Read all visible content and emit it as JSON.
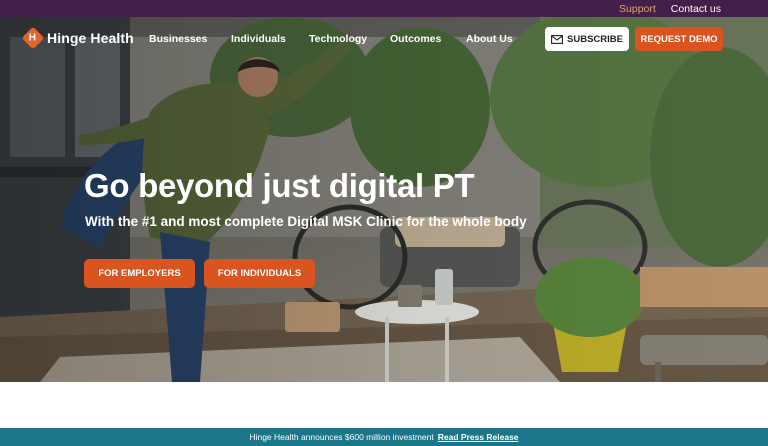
{
  "utility_bar": {
    "support_label": "Support",
    "contact_label": "Contact us"
  },
  "nav": {
    "logo_text": "Hinge Health",
    "logo_letter": "H",
    "links": [
      "Businesses",
      "Individuals",
      "Technology",
      "Outcomes",
      "About Us"
    ],
    "subscribe_label": "SUBSCRIBE",
    "demo_label": "REQUEST DEMO"
  },
  "hero": {
    "title": "Go beyond just digital PT",
    "subtitle": "With the #1 and most complete Digital MSK Clinic for the whole body",
    "cta_employers": "FOR EMPLOYERS",
    "cta_individuals": "FOR INDIVIDUALS"
  },
  "announcement": {
    "text": "Hinge Health announces $600 million investment",
    "link_label": "Read Press Release"
  },
  "colors": {
    "utility_bg": "#43204a",
    "support_text": "#e7a168",
    "accent_orange": "#d9541e",
    "announcement_bg": "#1a7688"
  },
  "icons": {
    "logo": "hinge-diamond-icon",
    "subscribe": "envelope-icon"
  }
}
